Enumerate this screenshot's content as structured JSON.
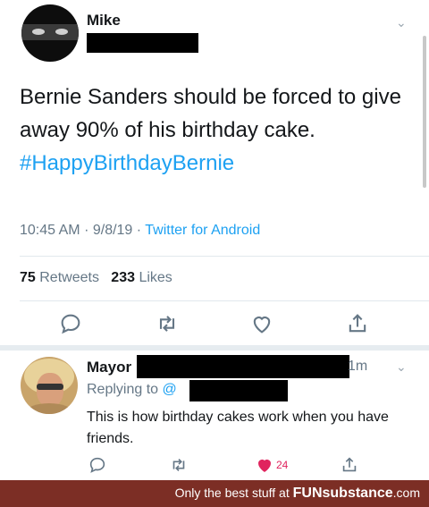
{
  "tweet": {
    "author": "Mike",
    "text": "Bernie Sanders should be forced to give away 90% of his birthday cake.",
    "hashtag": "#HappyBirthdayBernie",
    "time": "10:45 AM",
    "date": "9/8/19",
    "client": "Twitter for Android",
    "retweets_count": "75",
    "retweets_label": "Retweets",
    "likes_count": "233",
    "likes_label": "Likes"
  },
  "reply": {
    "author": "Mayor",
    "time": "1m",
    "replying_label": "Replying to",
    "replying_handle": "@",
    "text": "This is how birthday cakes work when you have friends.",
    "likes_count": "24"
  },
  "footer": {
    "prefix": "Only the best stuff at",
    "brand": "FUNsubstance",
    "suffix": ".com"
  },
  "colors": {
    "link": "#1da1f2",
    "muted": "#657786",
    "like": "#e0245e",
    "footer_bg": "#7c2e25"
  },
  "icons": [
    "reply-icon",
    "retweet-icon",
    "like-icon",
    "share-icon",
    "chevron-down-icon"
  ]
}
